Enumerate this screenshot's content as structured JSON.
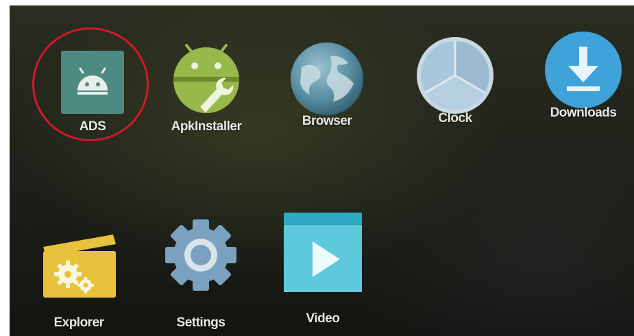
{
  "apps": [
    {
      "id": "ads",
      "label": "ADS",
      "icon": "android-robot-icon",
      "color": "#4f8a82"
    },
    {
      "id": "apkinstaller",
      "label": "ApkInstaller",
      "icon": "apk-installer-icon",
      "color": "#97b84a"
    },
    {
      "id": "browser",
      "label": "Browser",
      "icon": "globe-icon",
      "color": "#5a8fa3"
    },
    {
      "id": "clock",
      "label": "Clock",
      "icon": "clock-icon",
      "color": "#a8c6dc"
    },
    {
      "id": "downloads",
      "label": "Downloads",
      "icon": "download-icon",
      "color": "#3fa2d8"
    },
    {
      "id": "explorer",
      "label": "Explorer",
      "icon": "folder-gears-icon",
      "color": "#e8c23c"
    },
    {
      "id": "settings",
      "label": "Settings",
      "icon": "gear-icon",
      "color": "#7aa2c0"
    },
    {
      "id": "video",
      "label": "Video",
      "icon": "play-icon",
      "color": "#2fa9c4"
    }
  ],
  "highlight": {
    "target": "ADS",
    "color": "#d3182a"
  }
}
